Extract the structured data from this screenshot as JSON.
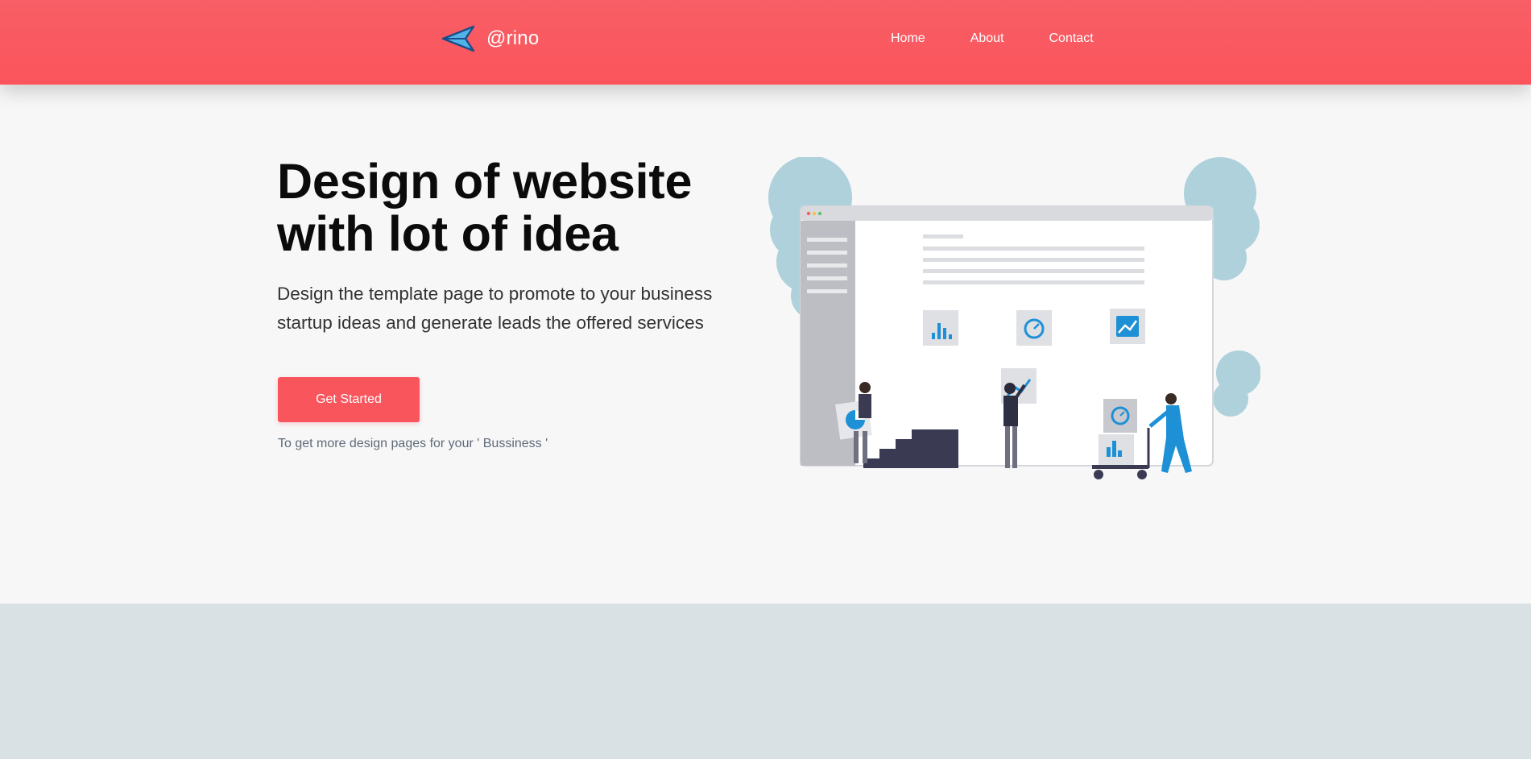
{
  "brand": {
    "name": "@rino",
    "icon": "paper-plane-icon"
  },
  "nav": {
    "items": [
      {
        "label": "Home"
      },
      {
        "label": "About"
      },
      {
        "label": "Contact"
      }
    ]
  },
  "hero": {
    "title_line1": "Design of website",
    "title_line2": "with lot of idea",
    "subtitle_line1": "Design the template page to promote to your business",
    "subtitle_line2": "startup ideas and generate leads the offered services",
    "cta_label": "Get Started",
    "note": "To get more design pages for your ' Bussiness '"
  },
  "colors": {
    "accent": "#f9555d",
    "nav_bg": "#fb545c",
    "hero_bg": "#f7f7f7",
    "footer_bg": "#dae1e5",
    "illustration_blue": "#1e90d6",
    "plant_blue": "#aed1dc"
  }
}
